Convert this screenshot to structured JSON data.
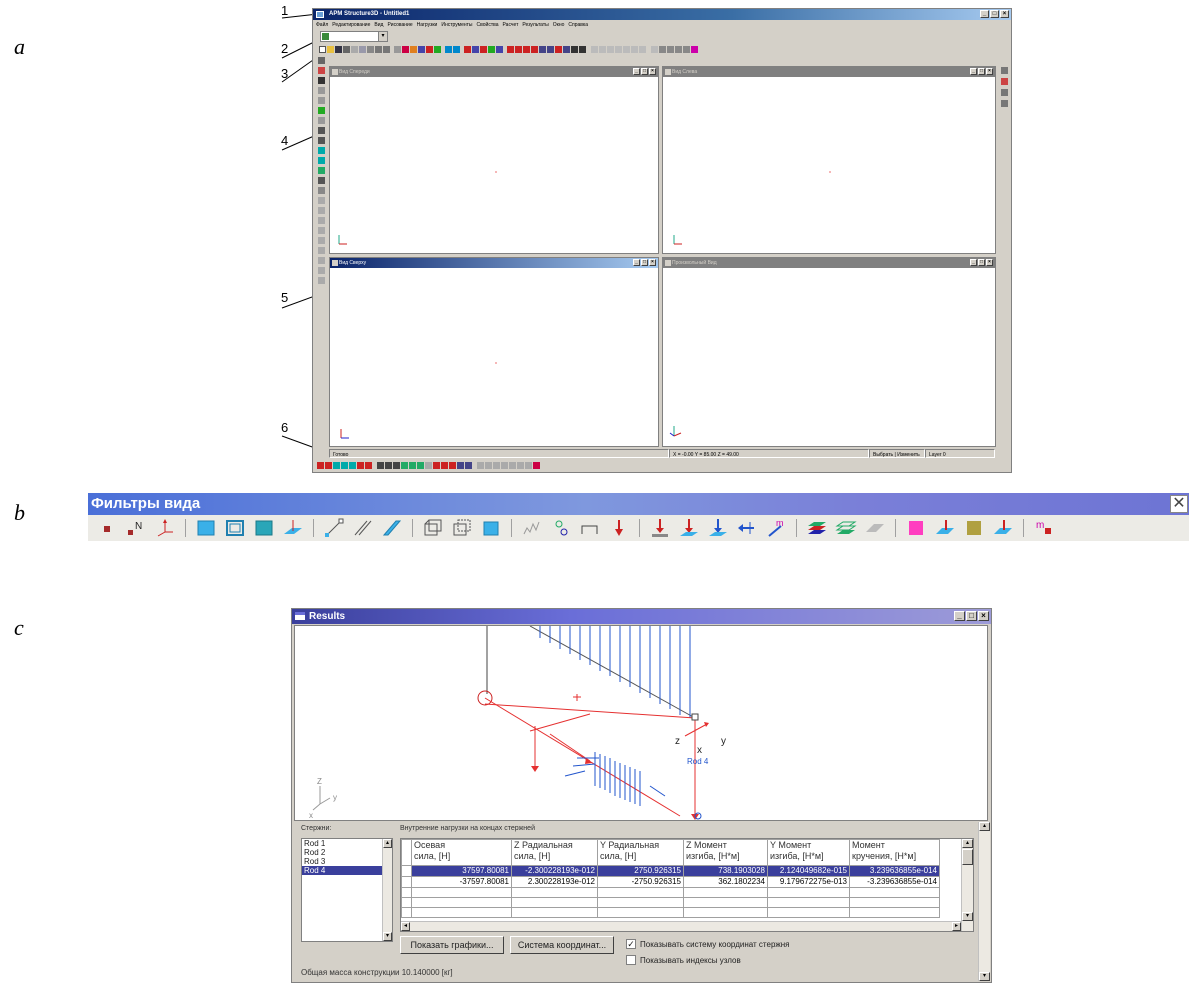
{
  "panel_labels": {
    "a": "a",
    "b": "b",
    "c": "c"
  },
  "callouts": [
    "1",
    "2",
    "3",
    "4",
    "5",
    "6"
  ],
  "app": {
    "title": "APM Structure3D - Untitled1",
    "menu": [
      "Файл",
      "Редактирование",
      "Вид",
      "Рисование",
      "Нагрузки",
      "Инструменты",
      "Свойства",
      "Расчет",
      "Результаты",
      "Окно",
      "Справка"
    ],
    "subwindows": {
      "front": "Вид Спереди",
      "side": "Вид Слева",
      "top": "Вид Сверху",
      "iso": "Произвольный Вид"
    },
    "status": {
      "mode": "Готово",
      "coords": "X = -0.00 Y = 85.00 Z = 49.00",
      "action": "Выбрать | Изменить",
      "layer": "Layer 0"
    }
  },
  "filters": {
    "title": "Фильтры вида",
    "close": "✕",
    "icons": [
      "node-icon",
      "node-label-icon",
      "local-axes-icon",
      "surface-icon",
      "surface-outline-icon",
      "solid-icon",
      "plate-axes-icon",
      "rod-icon",
      "rod-outline-icon",
      "rod-solid-icon",
      "element-icon",
      "element-outline-icon",
      "element-solid-icon",
      "spring-icon",
      "hinge-icon",
      "support-icon",
      "force-icon",
      "distributed-load-icon",
      "distributed-load-2-icon",
      "distributed-load-3-icon",
      "moment-load-icon",
      "moment-m-icon",
      "layers-icon",
      "layers-outline-icon",
      "layers-ghost-icon",
      "pressure-icon",
      "pressure-plate-icon",
      "temperature-icon",
      "temperature-plate-icon",
      "mass-icon"
    ],
    "labels": {
      "node_label": "N",
      "moment_m": "m",
      "mass_m": "m"
    },
    "colors": {
      "title_start": "#4a6fd8",
      "title_end": "#6d74d4"
    }
  },
  "results": {
    "title": "Results",
    "view": {
      "axis_labels": {
        "z": "z",
        "y": "y",
        "x": "x"
      },
      "rod_label": "Rod 4",
      "corner_axes": {
        "z": "Z",
        "y": "y",
        "x": "x"
      }
    },
    "rods_label": "Стержни:",
    "rods": [
      "Rod 1",
      "Rod 2",
      "Rod 3",
      "Rod 4"
    ],
    "selected_rod": "Rod 4",
    "forces_label": "Внутренние нагрузки на концах стержней",
    "columns": [
      {
        "l1": "Осевая",
        "l2": "сила, [Н]"
      },
      {
        "l1": "Z Радиальная",
        "l2": "сила, [Н]"
      },
      {
        "l1": "Y Радиальная",
        "l2": "сила, [Н]"
      },
      {
        "l1": "Z Момент",
        "l2": "изгиба, [Н*м]"
      },
      {
        "l1": "Y Момент",
        "l2": "изгиба, [Н*м]"
      },
      {
        "l1": "Момент",
        "l2": "кручения, [Н*м]"
      }
    ],
    "rows": [
      [
        "37597.80081",
        "-2.300228193e-012",
        "2750.926315",
        "738.1903028",
        "2.124049682e-015",
        "3.239636855e-014"
      ],
      [
        "-37597.80081",
        "2.300228193e-012",
        "-2750.926315",
        "362.1802234",
        "9.179672275e-013",
        "-3.239636855e-014"
      ]
    ],
    "buttons": {
      "show_graphs": "Показать графики...",
      "coord_system": "Система координат..."
    },
    "checkboxes": [
      {
        "label": "Показывать систему координат стержня",
        "checked": true
      },
      {
        "label": "Показывать индексы узлов",
        "checked": false
      }
    ],
    "check_mark": "✓",
    "total_mass": "Общая масса конструкции  10.140000 [кг]"
  }
}
